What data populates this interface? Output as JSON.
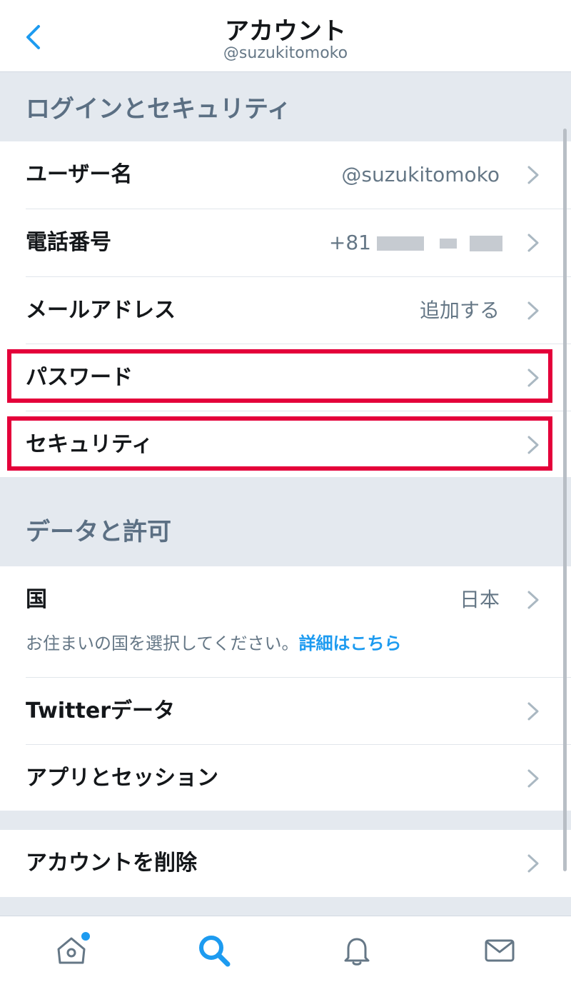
{
  "header": {
    "title": "アカウント",
    "subtitle": "@suzukitomoko"
  },
  "sections": {
    "login_security": {
      "title": "ログインとセキュリティ",
      "rows": {
        "username": {
          "label": "ユーザー名",
          "value": "@suzukitomoko"
        },
        "phone": {
          "label": "電話番号",
          "value_visible": "+81"
        },
        "email": {
          "label": "メールアドレス",
          "value": "追加する"
        },
        "password": {
          "label": "パスワード"
        },
        "security": {
          "label": "セキュリティ"
        }
      }
    },
    "data_permissions": {
      "title": "データと許可",
      "rows": {
        "country": {
          "label": "国",
          "value": "日本",
          "hint": "お住まいの国を選択してください。",
          "hint_link": "詳細はこちら"
        },
        "twitter_data": {
          "label": "Twitterデータ"
        },
        "apps_sessions": {
          "label": "アプリとセッション"
        }
      }
    },
    "danger": {
      "rows": {
        "delete_account": {
          "label": "アカウントを削除"
        }
      }
    }
  },
  "tabbar": {
    "icons": [
      "home-icon",
      "search-icon",
      "bell-icon",
      "mail-icon"
    ],
    "active": "search-icon"
  },
  "colors": {
    "accent": "#1d9bf0",
    "highlight_box": "#e4003a",
    "section_bg": "#e4e9ef",
    "secondary_text": "#657786"
  }
}
